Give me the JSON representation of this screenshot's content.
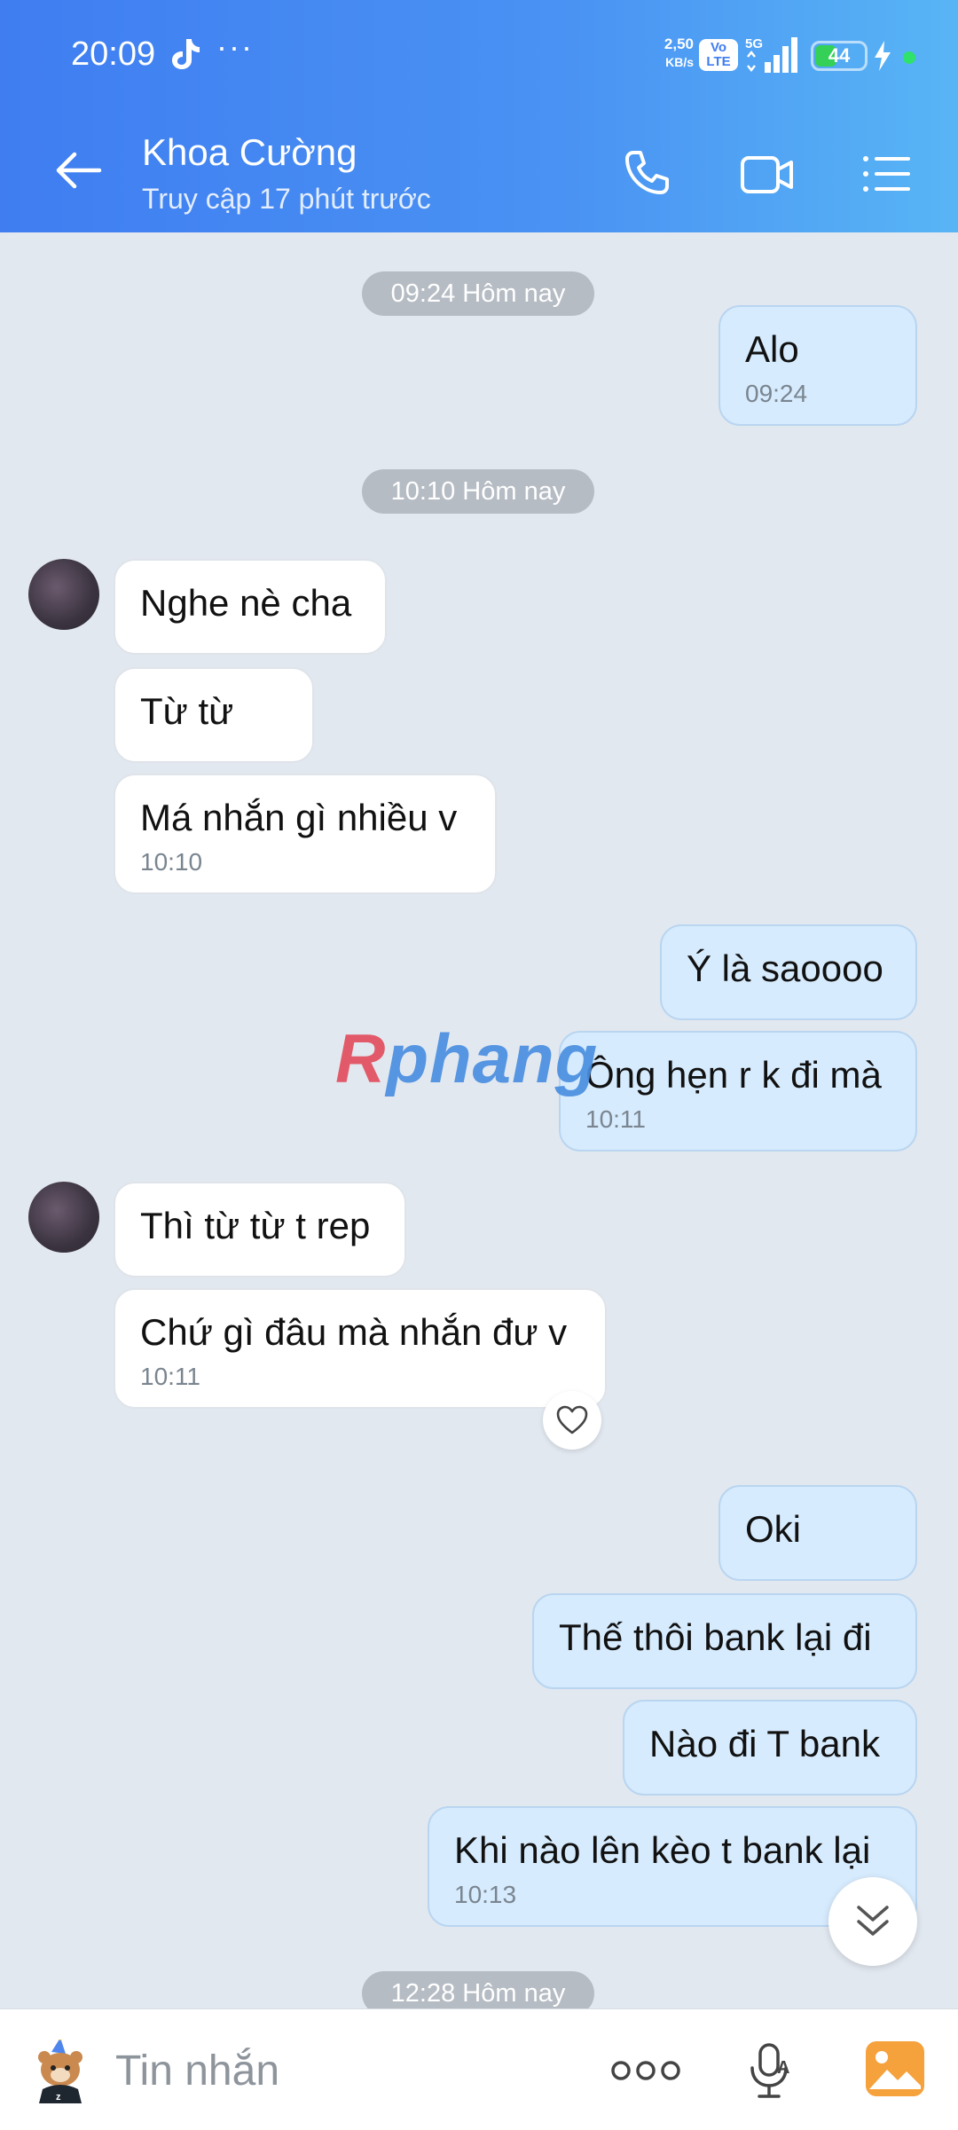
{
  "status_bar": {
    "time": "20:09",
    "more": "···",
    "net_speed_value": "2,50",
    "net_speed_unit": "KB/s",
    "volte_line1": "Vo",
    "volte_line2": "LTE",
    "network": "5G",
    "battery": "44",
    "battery_level": 0.44
  },
  "header": {
    "contact_name": "Khoa Cường",
    "status": "Truy cập 17 phút trước"
  },
  "chat": {
    "dividers": [
      "09:24 Hôm nay",
      "10:10 Hôm nay",
      "12:28 Hôm nay"
    ],
    "messages": [
      {
        "dir": "out",
        "text": "Alo",
        "time": "09:24"
      },
      {
        "dir": "in",
        "text": "Nghe nè cha"
      },
      {
        "dir": "in",
        "text": "Từ từ"
      },
      {
        "dir": "in",
        "text": "Má nhắn gì nhiều v",
        "time": "10:10"
      },
      {
        "dir": "out",
        "text": "Ý là saoooo"
      },
      {
        "dir": "out",
        "text": "Ông hẹn r k đi mà",
        "time": "10:11"
      },
      {
        "dir": "in",
        "text": "Thì từ từ t rep"
      },
      {
        "dir": "in",
        "text": "Chứ gì đâu mà nhắn đư v",
        "time": "10:11"
      },
      {
        "dir": "out",
        "text": "Oki"
      },
      {
        "dir": "out",
        "text": "Thế thôi bank lại đi"
      },
      {
        "dir": "out",
        "text": "Nào đi T bank"
      },
      {
        "dir": "out",
        "text": "Khi nào lên kèo t bank lại",
        "time": "10:13"
      }
    ]
  },
  "watermark": {
    "first": "R",
    "rest": "phang"
  },
  "input_bar": {
    "placeholder": "Tin nhắn"
  },
  "colors": {
    "header_start": "#3f7df1",
    "header_end": "#58b5f5",
    "bubble_out": "#d6ebfd",
    "bubble_in": "#ffffff",
    "chat_bg": "#e2e8f0"
  }
}
